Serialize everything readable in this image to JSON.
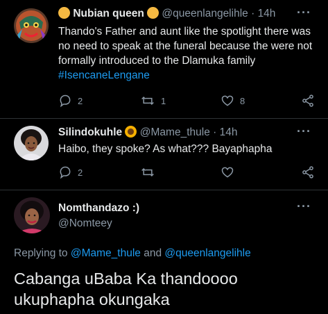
{
  "tweet1": {
    "name": "Nubian queen",
    "handle": "@queenlangelihle",
    "dot": "·",
    "time": "14h",
    "text": "Thando's Father and aunt like the spotlight there was no need to speak at the funeral because the were not formally introduced to the Dlamuka family",
    "hashtag": "#IsencaneLengane",
    "reply_count": "2",
    "retweet_count": "1",
    "like_count": "8"
  },
  "tweet2": {
    "name": "Silindokuhle",
    "handle": "@Mame_thule",
    "dot": "·",
    "time": "14h",
    "text": "Haibo, they spoke? As what??? Bayaphapha",
    "reply_count": "2"
  },
  "tweet3": {
    "name": "Nomthandazo :)",
    "handle": "@Nomteey",
    "replying_prefix": "Replying to",
    "mention1": "@Mame_thule",
    "and": "and",
    "mention2": "@queenlangelihle",
    "text": "Cabanga uBaba Ka thandoooo ukuphapha okungaka"
  },
  "icons": {
    "more": "more-icon",
    "reply": "reply-icon",
    "retweet": "retweet-icon",
    "like": "like-icon",
    "share": "share-icon"
  },
  "colors": {
    "background": "#000000",
    "text": "#e7e9ea",
    "muted": "#8b98a5",
    "accent": "#1d9bf0"
  }
}
